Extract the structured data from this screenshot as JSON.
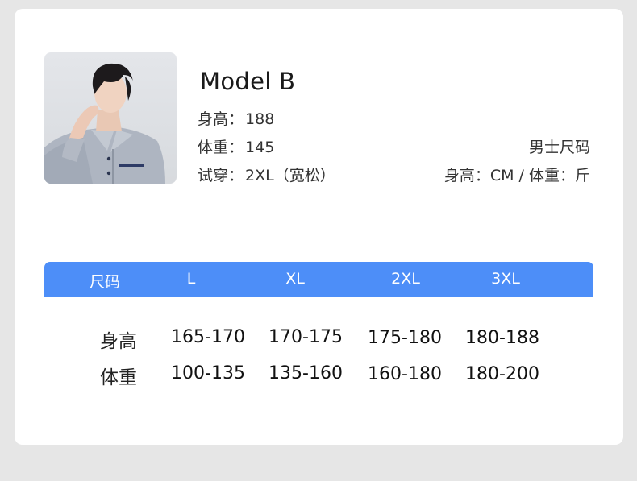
{
  "model": {
    "name": "Model B",
    "height_label": "身高：",
    "height_value": "188",
    "weight_label": "体重：",
    "weight_value": "145",
    "fit_label": "试穿：",
    "fit_value": "2XL（宽松）"
  },
  "size_chart": {
    "title": "男士尺码",
    "units": "身高：CM / 体重：斤"
  },
  "table": {
    "headers": [
      "尺码",
      "L",
      "XL",
      "2XL",
      "3XL"
    ],
    "rows": [
      {
        "label": "身高",
        "values": [
          "165-170",
          "170-175",
          "175-180",
          "180-188"
        ]
      },
      {
        "label": "体重",
        "values": [
          "100-135",
          "135-160",
          "160-180",
          "180-200"
        ]
      }
    ]
  },
  "colors": {
    "header_bg": "#4d8ef8",
    "card_bg": "#ffffff",
    "page_bg": "#e6e6e6"
  }
}
